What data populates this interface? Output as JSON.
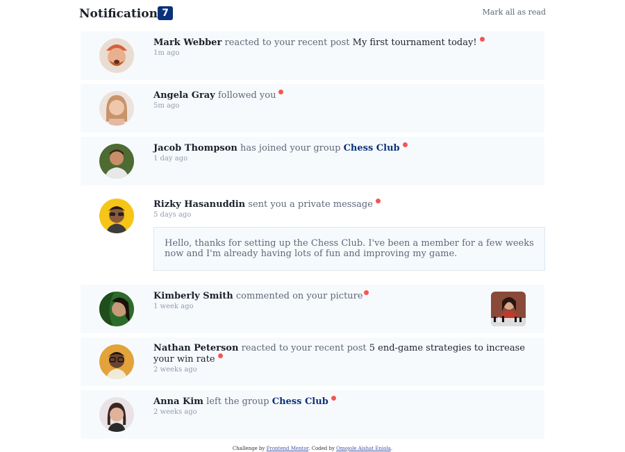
{
  "header": {
    "title": "Notifications",
    "count": "7",
    "mark_all": "Mark all as read"
  },
  "notifications": [
    {
      "name": "Mark Webber",
      "action": "reacted to your recent post",
      "target": "My first tournament today!",
      "time": "1m ago",
      "unread": true
    },
    {
      "name": "Angela Gray",
      "action": "followed you",
      "time": "5m ago",
      "unread": true
    },
    {
      "name": "Jacob Thompson",
      "action": "has joined your group",
      "group": "Chess Club",
      "time": "1 day ago",
      "unread": true
    },
    {
      "name": "Rizky Hasanuddin",
      "action": "sent you a private message",
      "time": "5 days ago",
      "unread": true,
      "message": "Hello, thanks for setting up the Chess Club. I've been a member for a few weeks now and I'm already having lots of fun and improving my game."
    },
    {
      "name": "Kimberly Smith",
      "action": "commented on your picture",
      "time": "1 week ago",
      "unread": true
    },
    {
      "name": "Nathan Peterson",
      "action": "reacted to your recent post",
      "target": "5 end-game strategies to increase your win rate",
      "time": "2 weeks ago",
      "unread": true
    },
    {
      "name": "Anna Kim",
      "action": "left the group",
      "group": "Chess Club",
      "time": "2 weeks ago",
      "unread": true
    }
  ],
  "footer": {
    "prefix": "Challenge by",
    "fm": "Frontend Mentor",
    "mid": ". Coded by",
    "author": "Omojole Aishat Eniola",
    "suffix": "."
  },
  "colors": {
    "navy": "#0a327b",
    "unread_bg": "#f7fafd",
    "dot": "#f65552"
  }
}
